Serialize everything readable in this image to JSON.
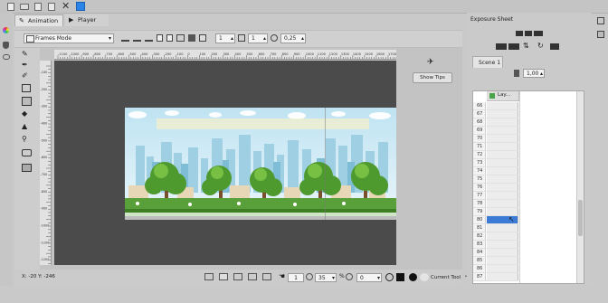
{
  "tabs": {
    "animation_label": "Animation",
    "player_label": "Player"
  },
  "toolbar": {
    "mode_select": "Frames Mode",
    "field_a": "1",
    "field_b": "1",
    "opacity": "0,25"
  },
  "side_panel": {
    "show_tips_label": "Show Tips"
  },
  "status": {
    "coordinates": "X: -20 Y: -246",
    "frame": "1",
    "zoom": "35",
    "rotation": "0",
    "current_tool_label": "Current Tool"
  },
  "exposure": {
    "title": "Exposure Sheet",
    "scene_tab": "Scene 1",
    "speed": "1,00",
    "layer_name": "Lay...",
    "frames": [
      "66",
      "67",
      "68",
      "69",
      "70",
      "71",
      "72",
      "73",
      "74",
      "75",
      "76",
      "77",
      "78",
      "79",
      "80",
      "81",
      "82",
      "83",
      "84",
      "85",
      "86",
      "87"
    ],
    "selected_frame": "80"
  },
  "ruler": {
    "labels": [
      "-1100",
      "-1000",
      "-900",
      "-800",
      "-700",
      "-600",
      "-500",
      "-400",
      "-300",
      "-200",
      "-100",
      "0",
      "100",
      "200",
      "300",
      "400",
      "500",
      "600",
      "700",
      "800",
      "900",
      "1000",
      "1100",
      "1200",
      "1300",
      "1400",
      "1500",
      "1600",
      "1700"
    ],
    "v_labels": [
      "-100",
      "-200",
      "-300",
      "-400",
      "-500",
      "-600",
      "-700",
      "-800",
      "-900",
      "-1000",
      "-1100",
      "-1200"
    ]
  },
  "colors": {
    "accent": "#3b7bd6",
    "layer_green": "#4aa34a",
    "sky": "#cbe9f4",
    "grass": "#4e9a2f"
  }
}
